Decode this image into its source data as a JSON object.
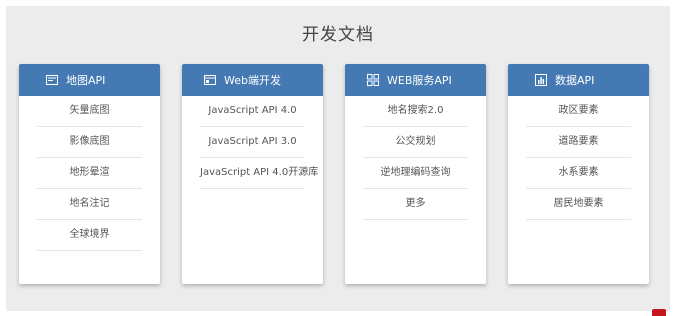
{
  "page_title": "开发文档",
  "cards": [
    {
      "title": "地图API",
      "icon": "map-icon",
      "items": [
        "矢量底图",
        "影像底图",
        "地形晕渲",
        "地名注记",
        "全球境界"
      ]
    },
    {
      "title": "Web端开发",
      "icon": "browser-window-icon",
      "items": [
        "JavaScript API 4.0",
        "JavaScript API 3.0",
        "JavaScript API 4.0开源库"
      ]
    },
    {
      "title": "WEB服务API",
      "icon": "grid-icon",
      "items": [
        "地名搜索2.0",
        "公交规划",
        "逆地理编码查询",
        "更多"
      ]
    },
    {
      "title": "数据API",
      "icon": "bar-chart-icon",
      "items": [
        "政区要素",
        "道路要素",
        "水系要素",
        "居民地要素"
      ]
    }
  ],
  "colors": {
    "header_blue": "#4479b3",
    "panel_bg": "#ececec",
    "corner_red": "#c4161c"
  }
}
